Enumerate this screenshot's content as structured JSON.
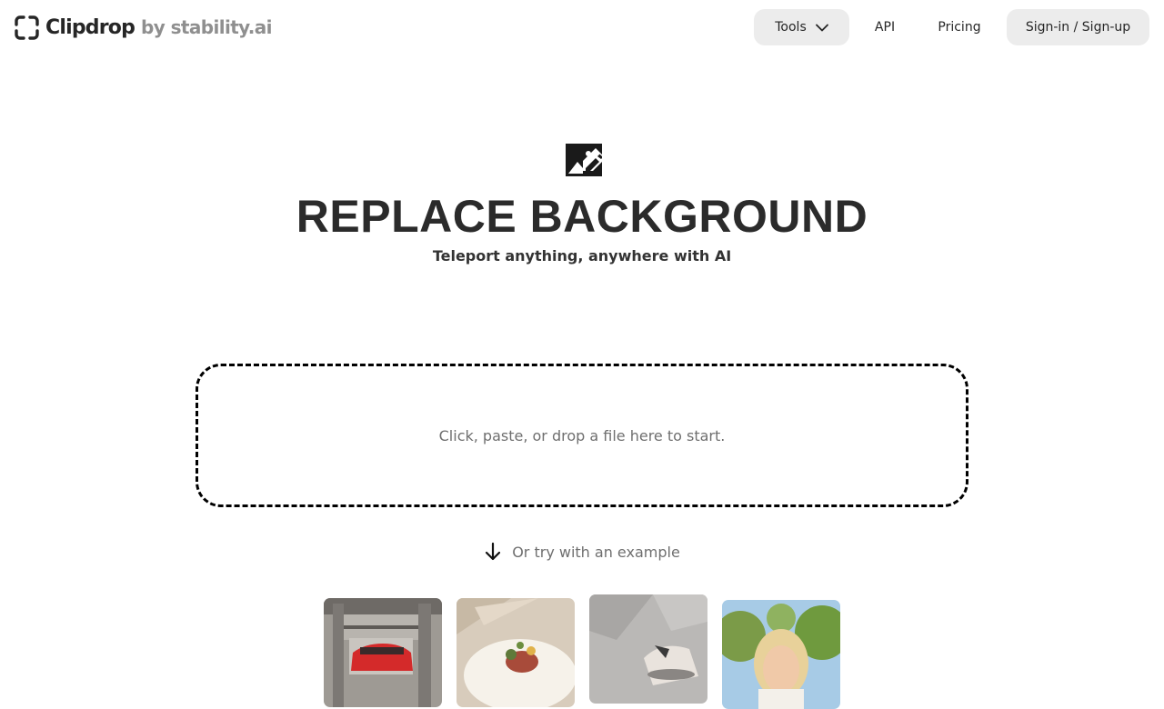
{
  "header": {
    "logo_name": "Clipdrop",
    "logo_by": "by stability.ai",
    "nav": {
      "tools_label": "Tools",
      "api_label": "API",
      "pricing_label": "Pricing",
      "signin_label": "Sign-in / Sign-up"
    }
  },
  "hero": {
    "icon": "image-edit-icon",
    "title": "REPLACE BACKGROUND",
    "subtitle": "Teleport anything, anywhere with AI"
  },
  "dropzone": {
    "text": "Click, paste, or drop a file here to start."
  },
  "examples": {
    "hint": "Or try with an example",
    "icon": "arrow-down-icon",
    "items": [
      {
        "subject": "red-car"
      },
      {
        "subject": "food-plate"
      },
      {
        "subject": "shoe"
      },
      {
        "subject": "woman-portrait"
      }
    ]
  },
  "colors": {
    "text": "#2b2b2b",
    "muted": "#6f6f6f",
    "button_bg": "#ececec",
    "border": "#000000"
  }
}
